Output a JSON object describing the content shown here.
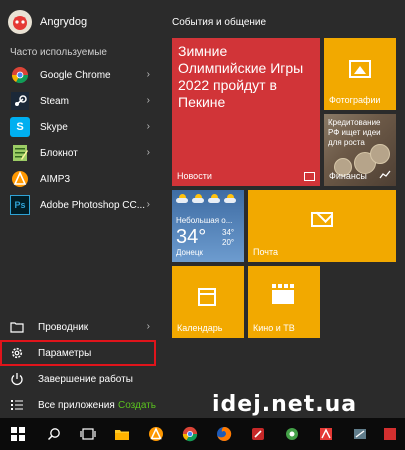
{
  "start_menu": {
    "user": {
      "name": "Angrydog",
      "avatar_icon": "user-avatar-icon"
    },
    "frequent_label": "Часто используемые",
    "apps": [
      {
        "name": "Google Chrome",
        "icon": "chrome-icon",
        "icon_color": "#4caf50",
        "has_submenu": true,
        "chevron": "›"
      },
      {
        "name": "Steam",
        "icon": "steam-icon",
        "icon_color": "#1b2838",
        "has_submenu": true,
        "chevron": "›"
      },
      {
        "name": "Skype",
        "icon": "skype-icon",
        "icon_color": "#00aff0",
        "glyph": "S",
        "has_submenu": true,
        "chevron": "›"
      },
      {
        "name": "Блокнот",
        "icon": "notepad-icon",
        "icon_color": "#9ccc65",
        "has_submenu": true,
        "chevron": "›"
      },
      {
        "name": "AIMP3",
        "icon": "aimp-icon",
        "icon_color": "#ff9800",
        "has_submenu": false
      },
      {
        "name": "Adobe Photoshop CC...",
        "icon": "photoshop-icon",
        "icon_color": "#2fa3d6",
        "glyph": "Ps",
        "has_submenu": true,
        "chevron": "›"
      }
    ],
    "bottom": {
      "explorer": {
        "label": "Проводник",
        "icon": "folder-icon",
        "chevron": "›"
      },
      "settings": {
        "label": "Параметры",
        "icon": "gear-icon"
      },
      "power": {
        "label": "Завершение работы",
        "icon": "power-icon"
      },
      "all_apps": {
        "label": "Все приложения",
        "icon": "all-apps-icon"
      },
      "create_label": "Создать"
    },
    "highlight_color": "#e0141b",
    "accent_color": "#5ac21f"
  },
  "tiles": {
    "group_title": "События и общение",
    "news": {
      "headline": "Зимние Олимпийские Игры 2022 пройдут в Пекине",
      "label": "Новости",
      "color": "#d13438"
    },
    "photos": {
      "label": "Фотографии",
      "color": "#f2a900"
    },
    "finance": {
      "headline": "Кредитование РФ ищет идеи для роста",
      "label": "Финансы"
    },
    "weather": {
      "condition": "Небольшая о...",
      "temperature": "34°",
      "high": "34°",
      "low": "20°",
      "city": "Донецк"
    },
    "mail": {
      "label": "Почта",
      "color": "#f2a900"
    },
    "calendar": {
      "label": "Календарь",
      "color": "#f2a900"
    },
    "movies": {
      "label": "Кино и ТВ",
      "color": "#f2a900"
    }
  },
  "taskbar": {
    "items": [
      {
        "icon": "windows-start-icon"
      },
      {
        "icon": "search-icon"
      },
      {
        "icon": "task-view-icon"
      },
      {
        "icon": "file-explorer-icon"
      },
      {
        "icon": "aimp-icon"
      },
      {
        "icon": "chrome-icon"
      },
      {
        "icon": "firefox-icon"
      },
      {
        "icon": "app-icon"
      },
      {
        "icon": "app-icon"
      },
      {
        "icon": "app-icon"
      },
      {
        "icon": "app-icon"
      },
      {
        "icon": "app-icon"
      }
    ]
  },
  "watermark": "idej.net.ua"
}
